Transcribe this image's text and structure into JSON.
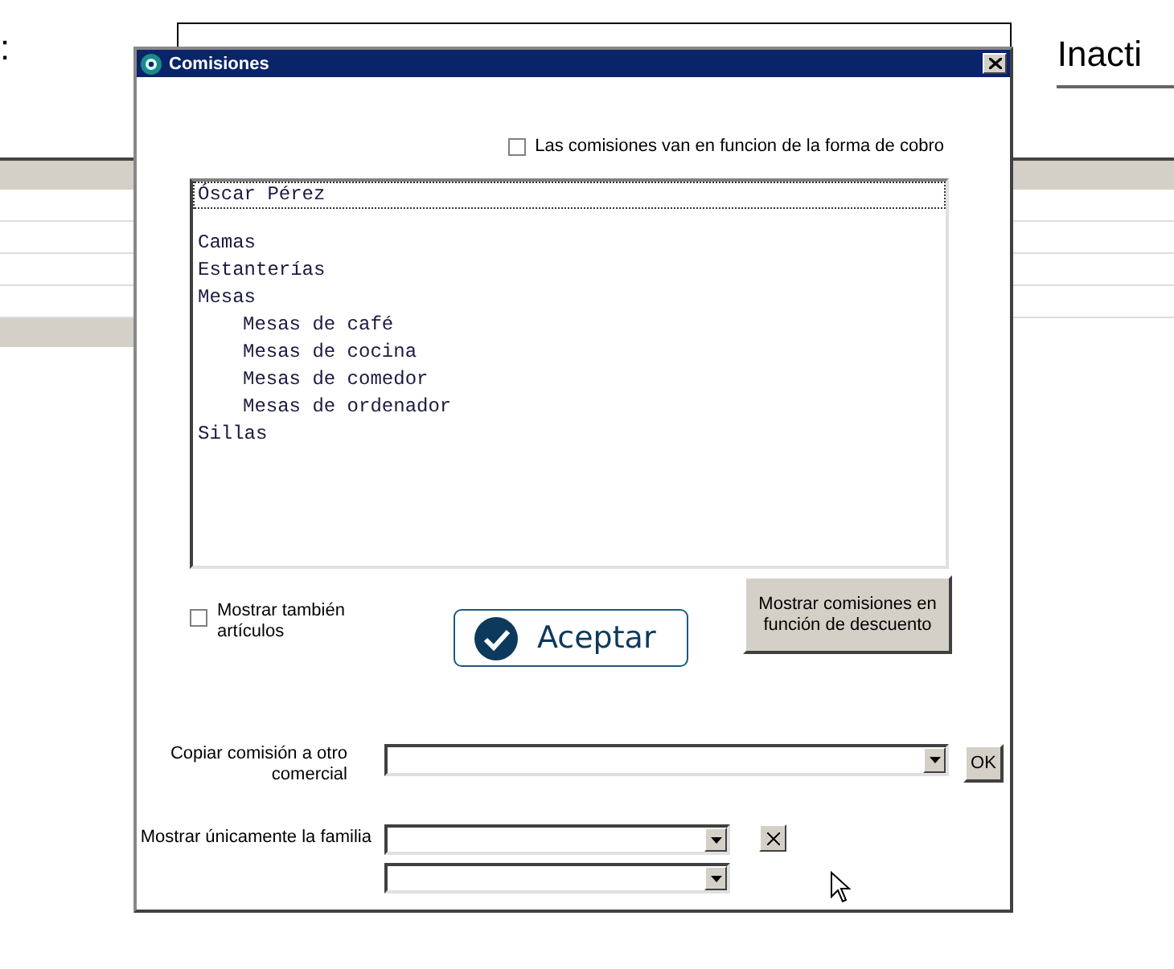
{
  "background": {
    "label_fragment": ":",
    "status_fragment": "Inacti"
  },
  "dialog": {
    "title": "Comisiones"
  },
  "payment_checkbox": {
    "label": "Las comisiones van en funcion de la forma de cobro",
    "checked": false
  },
  "list": {
    "owner": {
      "label": "Óscar Pérez",
      "selected": true
    },
    "items": [
      {
        "label": "Camas",
        "selected": false
      },
      {
        "label": "Estanterías",
        "selected": false
      },
      {
        "label": "Mesas",
        "selected": false,
        "children": [
          {
            "label": "Mesas de café",
            "selected": false
          },
          {
            "label": "Mesas de cocina",
            "selected": false
          },
          {
            "label": "Mesas de comedor",
            "selected": false
          },
          {
            "label": "Mesas de ordenador",
            "selected": false
          }
        ]
      },
      {
        "label": "Sillas",
        "selected": false
      }
    ]
  },
  "articles_checkbox": {
    "label": "Mostrar también artículos",
    "checked": false
  },
  "accept_button": "Aceptar",
  "discount_button": "Mostrar comisiones en función de descuento",
  "copy": {
    "label": "Copiar comisión a otro comercial",
    "button": "OK"
  },
  "family": {
    "label": "Mostrar únicamente la familia"
  }
}
